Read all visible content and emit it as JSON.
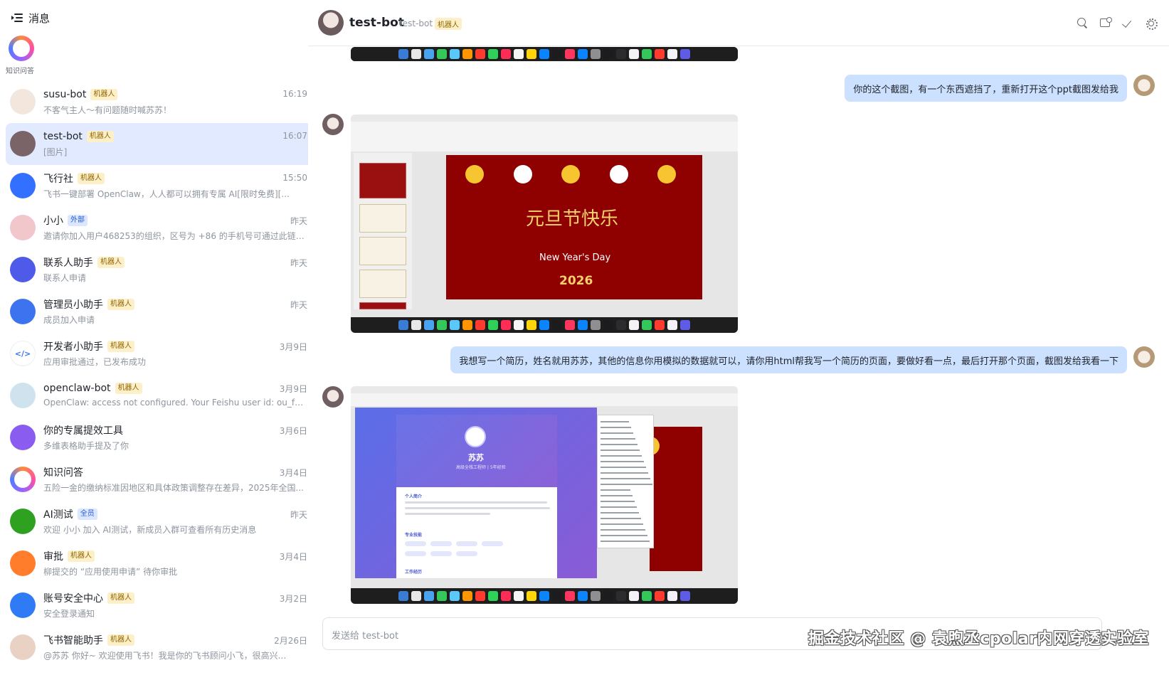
{
  "sidebar": {
    "title": "消息",
    "pinned": {
      "label": "知识问答"
    },
    "conversations": [
      {
        "name": "susu-bot",
        "tag": "机器人",
        "time": "16:19",
        "preview": "不客气主人～有问题随时喊苏苏！",
        "avatar_color": "#f3e6dc",
        "active": false
      },
      {
        "name": "test-bot",
        "tag": "机器人",
        "time": "16:07",
        "preview": "[图片]",
        "avatar_color": "#7a6468",
        "active": true
      },
      {
        "name": "飞行社",
        "tag": "机器人",
        "time": "15:50",
        "preview": "飞书一键部署 OpenClaw，人人都可以拥有专属 AI[限时免费][...",
        "avatar_color": "#3370ff",
        "active": false
      },
      {
        "name": "小小",
        "tag": "外部",
        "time": "昨天",
        "preview": "邀请你加入用户468253的组织，区号为 +86 的手机号可通过此链接...",
        "avatar_color": "#f2c7cc",
        "active": false
      },
      {
        "name": "联系人助手",
        "tag": "机器人",
        "time": "昨天",
        "preview": "联系人申请",
        "avatar_color": "#4e5be8",
        "active": false
      },
      {
        "name": "管理员小助手",
        "tag": "机器人",
        "time": "昨天",
        "preview": "成员加入申请",
        "avatar_color": "#3e73f0",
        "active": false
      },
      {
        "name": "开发者小助手",
        "tag": "机器人",
        "time": "3月9日",
        "preview": "应用审批通过，已发布成功",
        "avatar_color": "#ffffff",
        "active": false
      },
      {
        "name": "openclaw-bot",
        "tag": "机器人",
        "time": "3月9日",
        "preview": "OpenClaw: access not configured. Your Feishu user id: ou_f7f2c774...",
        "avatar_color": "#cfe3ee",
        "active": false
      },
      {
        "name": "你的专属提效工具",
        "tag": "",
        "time": "3月6日",
        "preview": "多维表格助手提及了你",
        "avatar_color": "#8a5cf0",
        "active": false
      },
      {
        "name": "知识问答",
        "tag": "",
        "time": "3月4日",
        "preview": "五险一金的缴纳标准因地区和具体政策调整存在差异，2025年全国...",
        "avatar_color": "ring",
        "active": false
      },
      {
        "name": "AI测试",
        "tag": "全员",
        "time": "昨天",
        "preview": "欢迎 小小 加入 AI测试，新成员入群可查看所有历史消息",
        "avatar_color": "#2ea121",
        "active": false
      },
      {
        "name": "审批",
        "tag": "机器人",
        "time": "3月4日",
        "preview": "柳提交的 “应用使用申请” 待你审批",
        "avatar_color": "#ff7d2b",
        "active": false
      },
      {
        "name": "账号安全中心",
        "tag": "机器人",
        "time": "3月2日",
        "preview": "安全登录通知",
        "avatar_color": "#2f7bf5",
        "active": false
      },
      {
        "name": "飞书智能助手",
        "tag": "机器人",
        "time": "2月26日",
        "preview": "@苏苏 你好~ 欢迎使用飞书！我是你的飞书顾问小飞，很高兴...",
        "avatar_color": "#e9d2c4",
        "active": false
      }
    ]
  },
  "chat": {
    "title": "test-bot",
    "subtitle": "test-bot",
    "tag": "机器人",
    "messages": [
      {
        "from": "me",
        "text": "你的这个截图，有一个东西遮挡了，重新打开这个ppt截图发给我"
      },
      {
        "from": "me",
        "text": "我想写一个简历，姓名就用苏苏，其他的信息你用模拟的数据就可以，请你用html帮我写一个简历的页面，要做好看一点，最后打开那个页面，截图发给我看一下"
      }
    ],
    "slide": {
      "title": "元旦节快乐",
      "subtitle": "New Year's Day",
      "year": "2026"
    },
    "resume": {
      "name": "苏苏",
      "role": "高级全栈工程师 | 5年经验",
      "section1": "个人简介",
      "section2": "专业技能",
      "section3": "工作经历"
    },
    "input_placeholder": "发送给 test-bot",
    "watermark": "掘金技术社区 @ 袁煦丞cpolar内网穿透实验室"
  },
  "colors": {
    "accent": "#3370ff",
    "bubble": "#cce0ff",
    "slide_red": "#8f0000",
    "gold": "#f7c52f"
  }
}
